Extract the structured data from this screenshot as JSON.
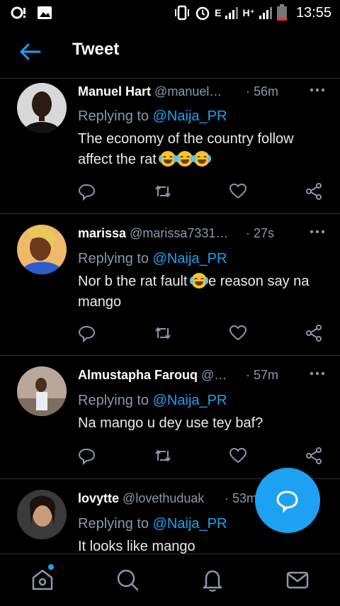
{
  "status_bar": {
    "time": "13:55",
    "network_1": "E",
    "network_2": "H⁺"
  },
  "header": {
    "title": "Tweet"
  },
  "colors": {
    "accent": "#1da1f2",
    "muted": "#8899a6",
    "divider": "#2f3336"
  },
  "tweets": [
    {
      "name": "Manuel Hart",
      "handle": "@manuel…",
      "time": "· 56m",
      "reply_prefix": "Replying to ",
      "mention": "@Naija_PR",
      "body": "The economy of the country follow affect the rat",
      "emoji_count": 3
    },
    {
      "name": "marissa",
      "handle": "@marissa7331…",
      "time": "· 27s",
      "reply_prefix": "Replying to ",
      "mention": "@Naija_PR",
      "body_before": "Nor b the rat fault ",
      "body_after": "e reason say na mango",
      "emoji_count": 1
    },
    {
      "name": "Almustapha Farouq",
      "handle": "@…",
      "time": "· 57m",
      "reply_prefix": "Replying to ",
      "mention": "@Naija_PR",
      "body": "Na mango u dey use tey baf?"
    },
    {
      "name": "lovytte",
      "handle": "@lovethuduak",
      "time": "· 53m",
      "reply_prefix": "Replying to ",
      "mention": "@Naija_PR",
      "body": "It looks like mango"
    }
  ],
  "icons": {
    "actions": [
      "reply-icon",
      "retweet-icon",
      "like-icon",
      "share-icon"
    ],
    "fab": "compose-reply-icon",
    "nav": [
      "home-icon",
      "search-icon",
      "notifications-icon",
      "messages-icon"
    ]
  }
}
